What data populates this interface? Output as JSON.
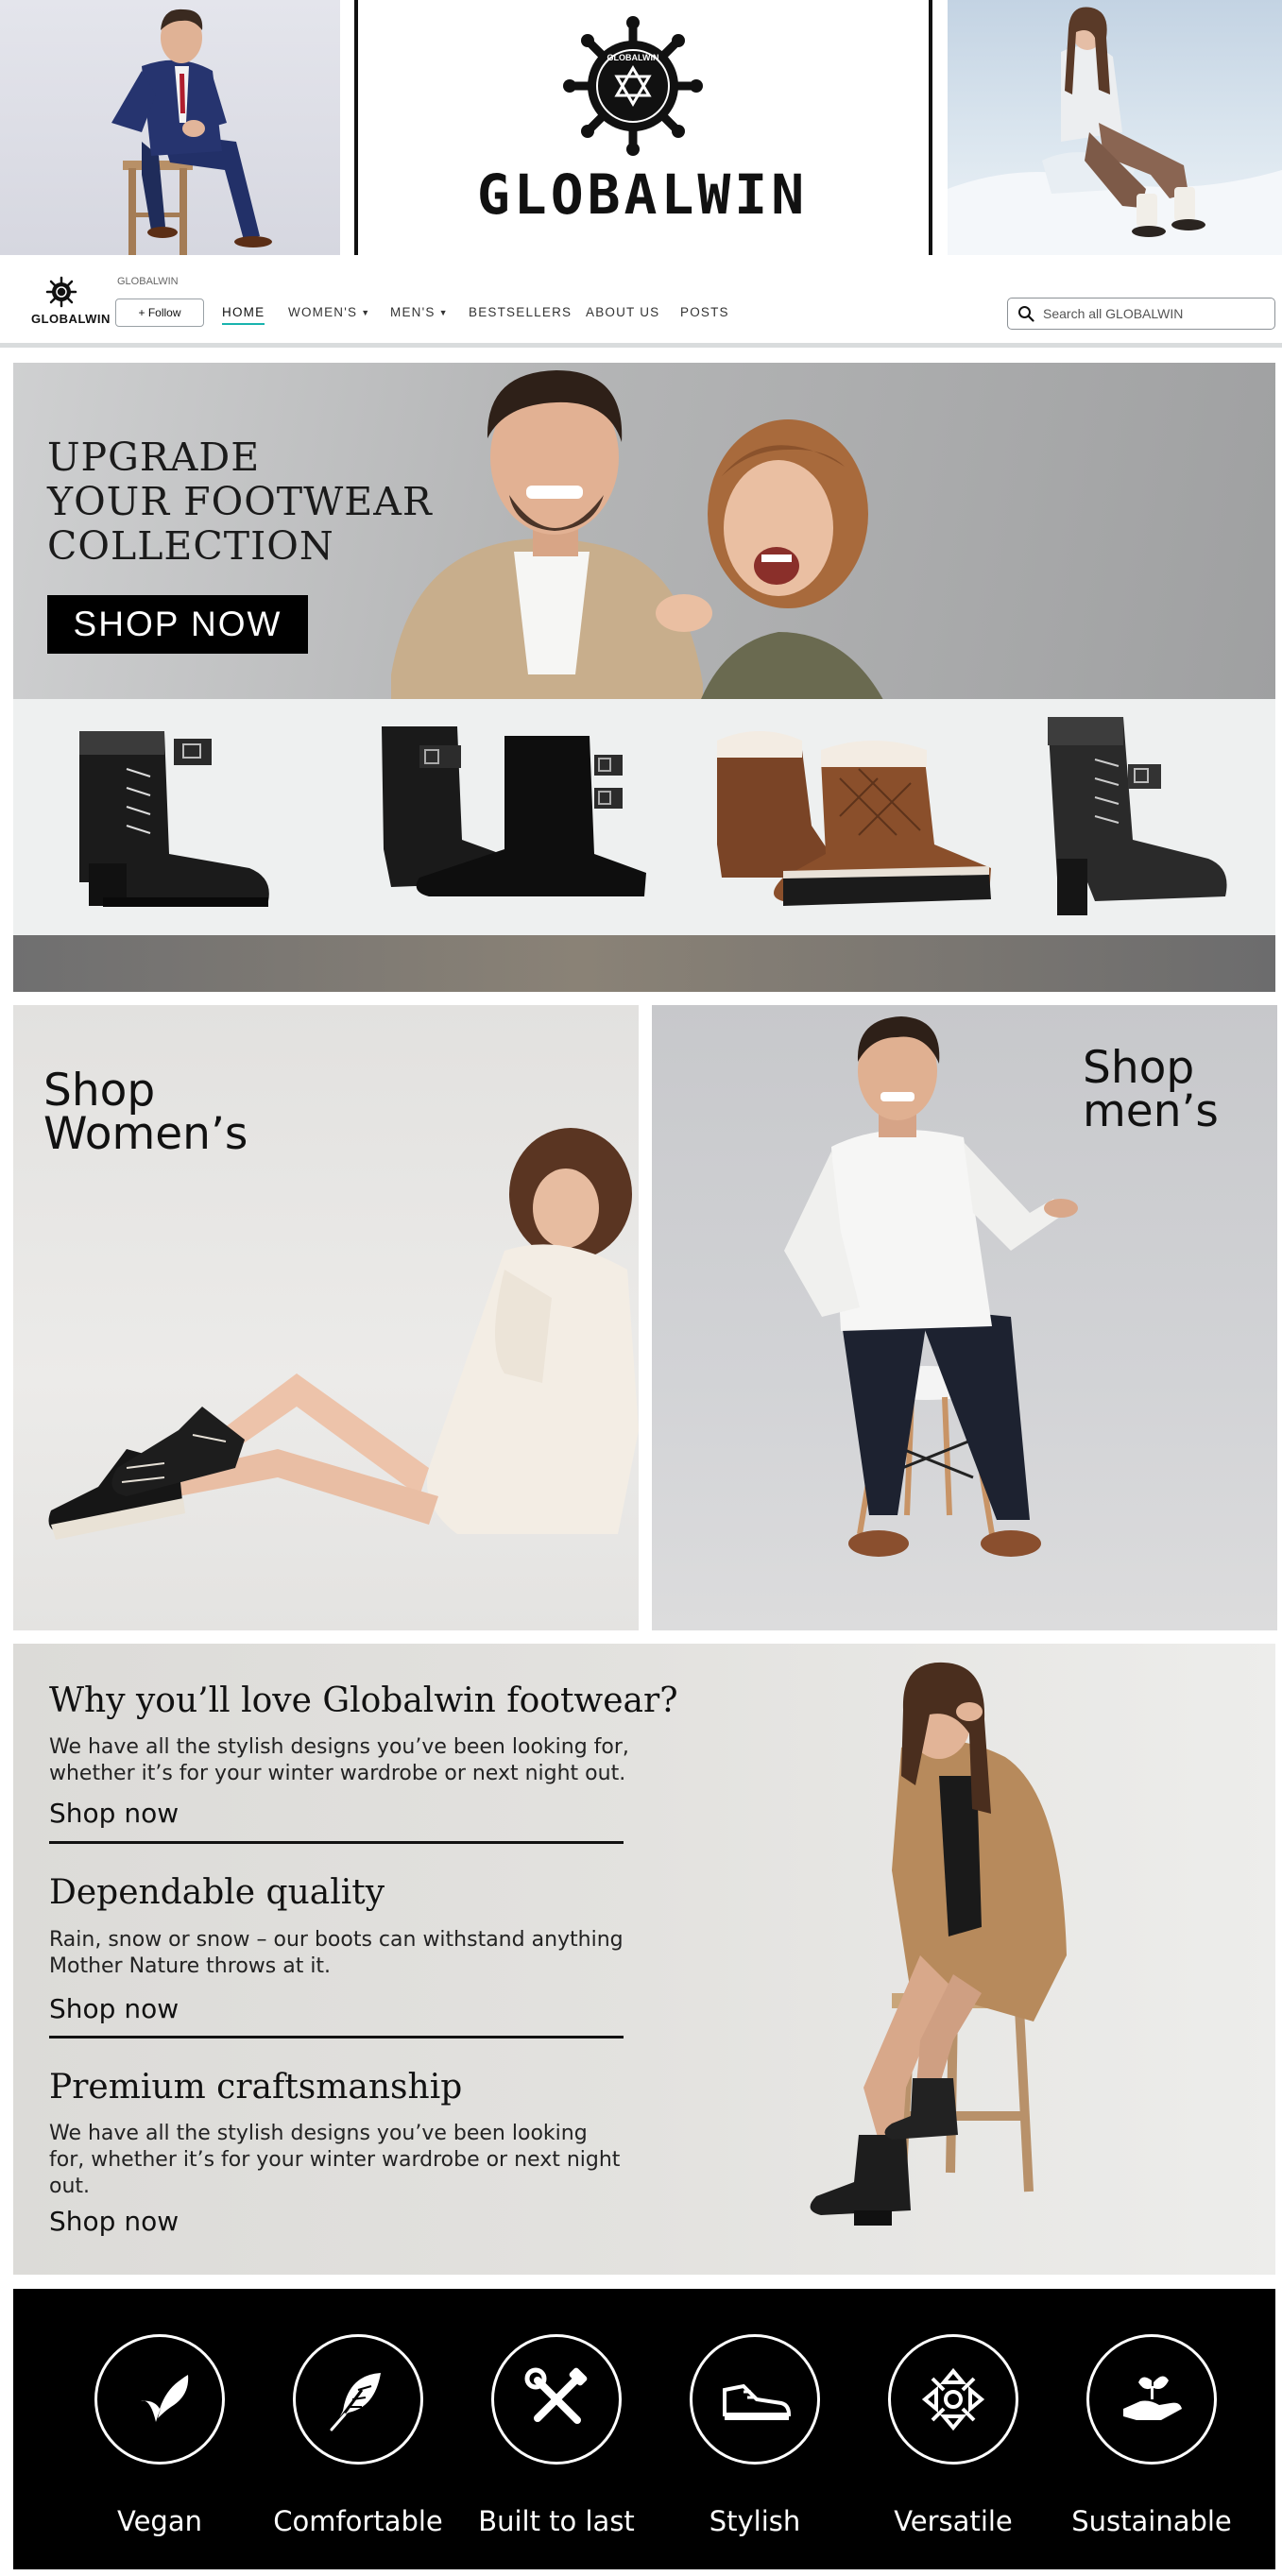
{
  "banner": {
    "brand_name": "GLOBALWIN",
    "logo_ring_text": "GLOBALWIN"
  },
  "nav": {
    "logo_text": "GLOBALWIN",
    "store_name": "GLOBALWIN",
    "follow_label": "+ Follow",
    "links": [
      {
        "label": "HOME",
        "active": true
      },
      {
        "label": "WOMEN'S",
        "has_dropdown": true
      },
      {
        "label": "MEN'S",
        "has_dropdown": true
      },
      {
        "label": "BESTSELLERS"
      },
      {
        "label": "ABOUT US"
      },
      {
        "label": "POSTS"
      }
    ],
    "search": {
      "placeholder": "Search all GLOBALWIN",
      "value": ""
    }
  },
  "hero": {
    "title_line1": "UPGRADE",
    "title_line2": "YOUR FOOTWEAR",
    "title_line3": "COLLECTION",
    "cta_label": "SHOP NOW"
  },
  "categories": {
    "women_line1": "Shop",
    "women_line2": "Women’s",
    "men_line1": "Shop",
    "men_line2": "men’s"
  },
  "why": [
    {
      "heading": "Why you’ll love Globalwin footwear?",
      "body": "We have all the stylish designs you’ve been looking for, whether it’s for your winter wardrobe or next night out.",
      "link": "Shop now"
    },
    {
      "heading": "Dependable quality",
      "body": "Rain, snow or snow – our boots can withstand anything Mother Nature throws at it.",
      "link": "Shop now"
    },
    {
      "heading": "Premium craftsmanship",
      "body": "We have all the stylish designs you’ve been looking for, whether it’s for your winter wardrobe or next night out.",
      "link": "Shop now"
    }
  ],
  "features": [
    {
      "label": "Vegan",
      "icon": "leaf-icon"
    },
    {
      "label": "Comfortable",
      "icon": "feather-icon"
    },
    {
      "label": "Built to last",
      "icon": "tools-icon"
    },
    {
      "label": "Stylish",
      "icon": "sneaker-icon"
    },
    {
      "label": "Versatile",
      "icon": "arrows-icon"
    },
    {
      "label": "Sustainable",
      "icon": "hand-plant-icon"
    }
  ],
  "colors": {
    "accent": "#19b3ae",
    "black": "#000000",
    "why_bg": "#e3e2df"
  }
}
